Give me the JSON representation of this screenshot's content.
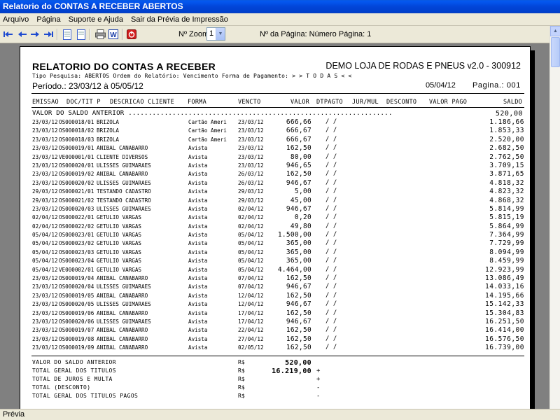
{
  "window": {
    "title": "Relatorio do CONTAS A RECEBER ABERTOS"
  },
  "menu": [
    "Arquivo",
    "Página",
    "Suporte e Ajuda",
    "Sair da Prévia de Impressão"
  ],
  "toolbar": {
    "zoom_label": "Nº Zoom",
    "zoom_value": "1",
    "page_label": "Nº da Página: Número Página: 1",
    "icons": [
      "first-page-icon",
      "prev-page-icon",
      "next-page-icon",
      "last-page-icon",
      "page-icon",
      "page-icon",
      "print-icon",
      "word-icon",
      "exit-icon"
    ]
  },
  "report": {
    "title": "RELATORIO DO CONTAS A RECEBER",
    "company": "DEMO LOJA DE RODAS E PNEUS v2.0 - 300912",
    "subtitle": "Tipo Pesquisa: ABERTOS    Ordem do Relatório: Vencimento   Forma de Pagamento: > > T O D A S < <",
    "periodo": "Período.: 23/03/12 à 05/05/12",
    "date": "05/04/12",
    "pagina": "Pagina.: 001",
    "columns": {
      "emissao": "EMISSAO",
      "doc": "DOC/TIT P",
      "descricao": "DESCRICAO CLIENTE",
      "forma": "FORMA",
      "vencto": "VENCTO",
      "valor": "VALOR",
      "dtpagto": "DTPAGTO",
      "jurmul": "JUR/MUL",
      "desconto": "DESCONTO",
      "valorpago": "VALOR PAGO",
      "saldo": "SALDO"
    },
    "saldo_anterior_label": "VALOR DO SALDO ANTERIOR ..................................................................",
    "saldo_anterior_value": "520,00",
    "rows": [
      {
        "emissao": "23/03/12",
        "doc": "OS000018/01",
        "cliente": "BRIZOLA",
        "forma": "Cartão Ameri",
        "vencto": "23/03/12",
        "valor": "666,66",
        "dt": "/  /",
        "saldo": "1.186,66"
      },
      {
        "emissao": "23/03/12",
        "doc": "OS000018/02",
        "cliente": "BRIZOLA",
        "forma": "Cartão Ameri",
        "vencto": "23/03/12",
        "valor": "666,67",
        "dt": "/  /",
        "saldo": "1.853,33"
      },
      {
        "emissao": "23/03/12",
        "doc": "OS000018/03",
        "cliente": "BRIZOLA",
        "forma": "Cartão Ameri",
        "vencto": "23/03/12",
        "valor": "666,67",
        "dt": "/  /",
        "saldo": "2.520,00"
      },
      {
        "emissao": "23/03/12",
        "doc": "OS000019/01",
        "cliente": "ANIBAL CANABARRO",
        "forma": "Avista",
        "vencto": "23/03/12",
        "valor": "162,50",
        "dt": "/  /",
        "saldo": "2.682,50"
      },
      {
        "emissao": "23/03/12",
        "doc": "VE000001/01",
        "cliente": "CLIENTE DIVERSOS",
        "forma": "Avista",
        "vencto": "23/03/12",
        "valor": "80,00",
        "dt": "/  /",
        "saldo": "2.762,50"
      },
      {
        "emissao": "23/03/12",
        "doc": "OS000020/01",
        "cliente": "ULISSES GUIMARAES",
        "forma": "Avista",
        "vencto": "23/03/12",
        "valor": "946,65",
        "dt": "/  /",
        "saldo": "3.709,15"
      },
      {
        "emissao": "23/03/12",
        "doc": "OS000019/02",
        "cliente": "ANIBAL CANABARRO",
        "forma": "Avista",
        "vencto": "26/03/12",
        "valor": "162,50",
        "dt": "/  /",
        "saldo": "3.871,65"
      },
      {
        "emissao": "23/03/12",
        "doc": "OS000020/02",
        "cliente": "ULISSES GUIMARAES",
        "forma": "Avista",
        "vencto": "26/03/12",
        "valor": "946,67",
        "dt": "/  /",
        "saldo": "4.818,32"
      },
      {
        "emissao": "29/03/12",
        "doc": "OS000021/01",
        "cliente": "TESTANDO CADASTRO",
        "forma": "Avista",
        "vencto": "29/03/12",
        "valor": "5,00",
        "dt": "/  /",
        "saldo": "4.823,32"
      },
      {
        "emissao": "29/03/12",
        "doc": "OS000021/02",
        "cliente": "TESTANDO CADASTRO",
        "forma": "Avista",
        "vencto": "29/03/12",
        "valor": "45,00",
        "dt": "/  /",
        "saldo": "4.868,32"
      },
      {
        "emissao": "23/03/12",
        "doc": "OS000020/03",
        "cliente": "ULISSES GUIMARAES",
        "forma": "Avista",
        "vencto": "02/04/12",
        "valor": "946,67",
        "dt": "/  /",
        "saldo": "5.814,99"
      },
      {
        "emissao": "02/04/12",
        "doc": "OS000022/01",
        "cliente": "GETULIO VARGAS",
        "forma": "Avista",
        "vencto": "02/04/12",
        "valor": "0,20",
        "dt": "/  /",
        "saldo": "5.815,19"
      },
      {
        "emissao": "02/04/12",
        "doc": "OS000022/02",
        "cliente": "GETULIO VARGAS",
        "forma": "Avista",
        "vencto": "02/04/12",
        "valor": "49,80",
        "dt": "/  /",
        "saldo": "5.864,99"
      },
      {
        "emissao": "05/04/12",
        "doc": "OS000023/01",
        "cliente": "GETULIO VARGAS",
        "forma": "Avista",
        "vencto": "05/04/12",
        "valor": "1.500,00",
        "dt": "/  /",
        "saldo": "7.364,99"
      },
      {
        "emissao": "05/04/12",
        "doc": "OS000023/02",
        "cliente": "GETULIO VARGAS",
        "forma": "Avista",
        "vencto": "05/04/12",
        "valor": "365,00",
        "dt": "/  /",
        "saldo": "7.729,99"
      },
      {
        "emissao": "05/04/12",
        "doc": "OS000023/03",
        "cliente": "GETULIO VARGAS",
        "forma": "Avista",
        "vencto": "05/04/12",
        "valor": "365,00",
        "dt": "/  /",
        "saldo": "8.094,99"
      },
      {
        "emissao": "05/04/12",
        "doc": "OS000023/04",
        "cliente": "GETULIO VARGAS",
        "forma": "Avista",
        "vencto": "05/04/12",
        "valor": "365,00",
        "dt": "/  /",
        "saldo": "8.459,99"
      },
      {
        "emissao": "05/04/12",
        "doc": "VE000002/01",
        "cliente": "GETULIO VARGAS",
        "forma": "Avista",
        "vencto": "05/04/12",
        "valor": "4.464,00",
        "dt": "/  /",
        "saldo": "12.923,99"
      },
      {
        "emissao": "23/03/12",
        "doc": "OS000019/04",
        "cliente": "ANIBAL CANABARRO",
        "forma": "Avista",
        "vencto": "07/04/12",
        "valor": "162,50",
        "dt": "/  /",
        "saldo": "13.086,49"
      },
      {
        "emissao": "23/03/12",
        "doc": "OS000020/04",
        "cliente": "ULISSES GUIMARAES",
        "forma": "Avista",
        "vencto": "07/04/12",
        "valor": "946,67",
        "dt": "/  /",
        "saldo": "14.033,16"
      },
      {
        "emissao": "23/03/12",
        "doc": "OS000019/05",
        "cliente": "ANIBAL CANABARRO",
        "forma": "Avista",
        "vencto": "12/04/12",
        "valor": "162,50",
        "dt": "/  /",
        "saldo": "14.195,66"
      },
      {
        "emissao": "23/03/12",
        "doc": "OS000020/05",
        "cliente": "ULISSES GUIMARAES",
        "forma": "Avista",
        "vencto": "12/04/12",
        "valor": "946,67",
        "dt": "/  /",
        "saldo": "15.142,33"
      },
      {
        "emissao": "23/03/12",
        "doc": "OS000019/06",
        "cliente": "ANIBAL CANABARRO",
        "forma": "Avista",
        "vencto": "17/04/12",
        "valor": "162,50",
        "dt": "/  /",
        "saldo": "15.304,83"
      },
      {
        "emissao": "23/03/12",
        "doc": "OS000020/06",
        "cliente": "ULISSES GUIMARAES",
        "forma": "Avista",
        "vencto": "17/04/12",
        "valor": "946,67",
        "dt": "/  /",
        "saldo": "16.251,50"
      },
      {
        "emissao": "23/03/12",
        "doc": "OS000019/07",
        "cliente": "ANIBAL CANABARRO",
        "forma": "Avista",
        "vencto": "22/04/12",
        "valor": "162,50",
        "dt": "/  /",
        "saldo": "16.414,00"
      },
      {
        "emissao": "23/03/12",
        "doc": "OS000019/08",
        "cliente": "ANIBAL CANABARRO",
        "forma": "Avista",
        "vencto": "27/04/12",
        "valor": "162,50",
        "dt": "/  /",
        "saldo": "16.576,50"
      },
      {
        "emissao": "23/03/12",
        "doc": "OS000019/09",
        "cliente": "ANIBAL CANABARRO",
        "forma": "Avista",
        "vencto": "02/05/12",
        "valor": "162,50",
        "dt": "/  /",
        "saldo": "16.739,00"
      }
    ],
    "totals": [
      {
        "label": "VALOR DO SALDO ANTERIOR",
        "rs": "R$",
        "value": "520,00",
        "sign": ""
      },
      {
        "label": "TOTAL GERAL DOS TITULOS",
        "rs": "R$",
        "value": "16.219,00",
        "sign": "+"
      },
      {
        "label": "TOTAL DE JUROS E MULTA",
        "rs": "R$",
        "value": "",
        "sign": "+"
      },
      {
        "label": "TOTAL (DESCONTO)",
        "rs": "R$",
        "value": "",
        "sign": "-"
      },
      {
        "label": "TOTAL GERAL DOS TITULOS PAGOS",
        "rs": "R$",
        "value": "",
        "sign": "-"
      }
    ]
  },
  "status": {
    "text": "Prévia"
  }
}
